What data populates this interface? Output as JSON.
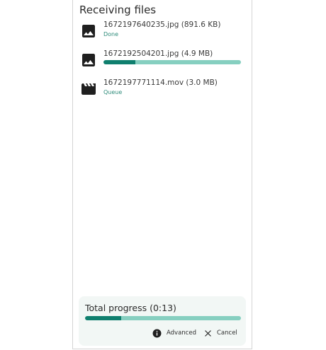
{
  "dialog": {
    "title": "Receiving files"
  },
  "files": [
    {
      "name": "1672197640235.jpg (891.6 KB)",
      "status": "Done",
      "icon": "image-icon",
      "progress": null
    },
    {
      "name": "1672192504201.jpg (4.9 MB)",
      "status": "",
      "icon": "image-icon",
      "progress": 0.23
    },
    {
      "name": "1672197771114.mov (3.0 MB)",
      "status": "Queue",
      "icon": "movie-icon",
      "progress": null
    }
  ],
  "total": {
    "label": "Total progress (0:13)",
    "progress": 0.23
  },
  "actions": {
    "advanced_label": "Advanced",
    "advanced_icon": "info-icon",
    "cancel_label": "Cancel",
    "cancel_icon": "close-icon"
  },
  "colors": {
    "accent": "#0f7f6e",
    "track": "#86cfc0",
    "status_text": "#2b8a78",
    "card_bg": "#f2f7f5"
  }
}
